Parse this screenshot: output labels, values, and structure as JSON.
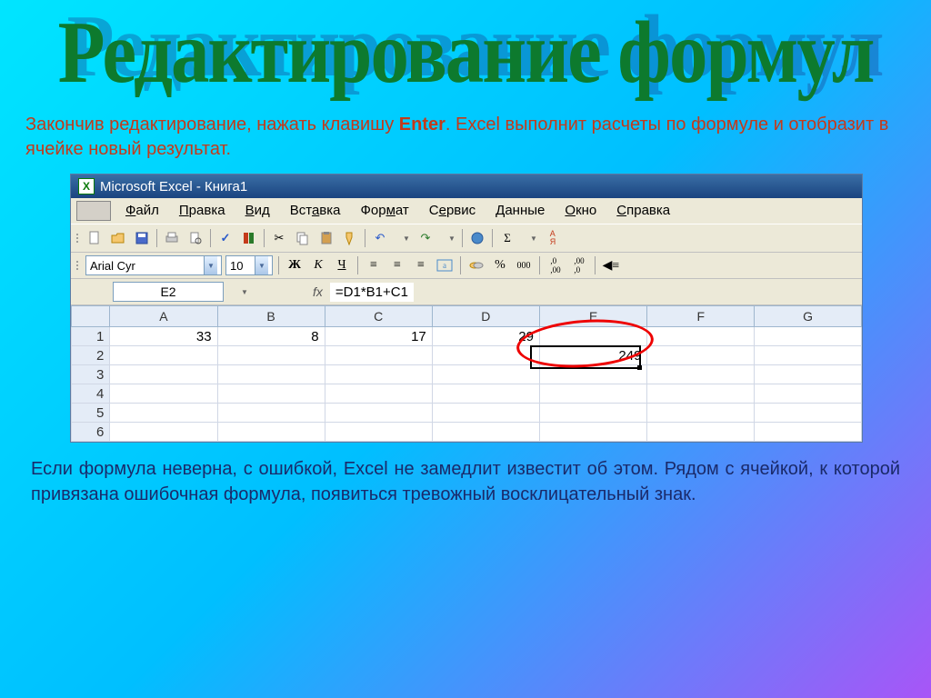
{
  "slide": {
    "title": "Редактирование формул",
    "desc_pre": "Закончив редактирование, нажать клавишу ",
    "desc_bold": "Enter",
    "desc_post": ". Excel выполнит расчеты по формуле и отобразит в ячейке новый результат.",
    "footer": "Если формула неверна, с ошибкой, Excel не замедлит  известит об этом. Рядом с ячейкой, к которой привязана ошибочная формула, появиться тревожный восклицательный знак."
  },
  "excel": {
    "app_title": "Microsoft Excel - Книга1",
    "menus": [
      "Файл",
      "Правка",
      "Вид",
      "Вставка",
      "Формат",
      "Сервис",
      "Данные",
      "Окно",
      "Справка"
    ],
    "font": "Arial Cyr",
    "font_size": "10",
    "namebox": "E2",
    "formula": "=D1*B1+C1",
    "columns": [
      "A",
      "B",
      "C",
      "D",
      "E",
      "F",
      "G"
    ],
    "rows": [
      "1",
      "2",
      "3",
      "4",
      "5",
      "6"
    ],
    "cells": {
      "A1": "33",
      "B1": "8",
      "C1": "17",
      "D1": "29",
      "E2": "249"
    },
    "fmt_buttons": {
      "bold": "Ж",
      "italic": "К",
      "underline": "Ч"
    },
    "currency": "%",
    "num": "000"
  }
}
